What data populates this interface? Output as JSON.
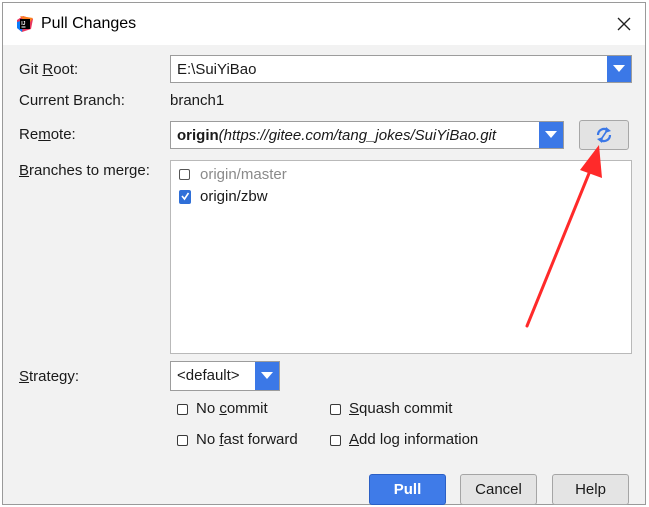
{
  "window": {
    "title": "Pull Changes",
    "close_label": "close"
  },
  "fields": {
    "git_root": {
      "label_pre": "Git ",
      "label_mnemonic": "R",
      "label_post": "oot:",
      "value": "E:\\SuiYiBao"
    },
    "current_branch": {
      "label": "Current Branch:",
      "value": "branch1"
    },
    "remote": {
      "label_pre": "Re",
      "label_mnemonic": "m",
      "label_post": "ote:",
      "name": "origin",
      "url": "(https://gitee.com/tang_jokes/SuiYiBao.git"
    },
    "branches": {
      "label_mnemonic": "B",
      "label_post": "ranches to merge:",
      "items": [
        {
          "name": "origin/master",
          "checked": false,
          "muted": true
        },
        {
          "name": "origin/zbw",
          "checked": true,
          "muted": false
        }
      ]
    },
    "strategy": {
      "label_mnemonic": "S",
      "label_post": "trategy:",
      "value": "<default>"
    }
  },
  "options": {
    "no_commit": {
      "pre": "No ",
      "mnemonic": "c",
      "post": "ommit"
    },
    "squash_commit": {
      "pre": "",
      "mnemonic": "S",
      "post": "quash commit"
    },
    "no_fast_forward": {
      "pre": "No ",
      "mnemonic": "f",
      "post": "ast forward"
    },
    "add_log": {
      "pre": "",
      "mnemonic": "A",
      "post": "dd log information"
    }
  },
  "buttons": {
    "pull": "Pull",
    "cancel": "Cancel",
    "help": "Help"
  },
  "colors": {
    "accent": "#3b78e7",
    "annotation": "#ff2a2a",
    "muted_text": "#8a8a8a"
  }
}
